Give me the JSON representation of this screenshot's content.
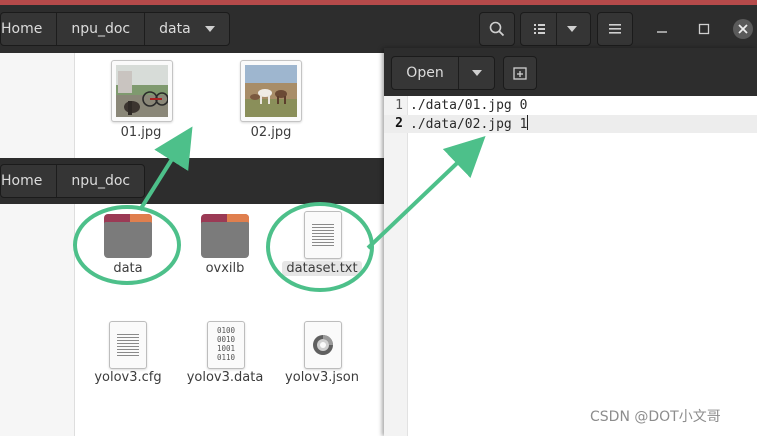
{
  "top_window": {
    "breadcrumbs": [
      "Home",
      "npu_doc",
      "data"
    ],
    "files": [
      {
        "name": "01.jpg"
      },
      {
        "name": "02.jpg"
      }
    ]
  },
  "front_window": {
    "breadcrumbs": [
      "Home",
      "npu_doc"
    ],
    "items": [
      {
        "name": "data",
        "kind": "folder"
      },
      {
        "name": "ovxilb",
        "kind": "folder"
      },
      {
        "name": "dataset.txt",
        "kind": "text-file"
      },
      {
        "name": "yolov3.cfg",
        "kind": "text-file"
      },
      {
        "name": "yolov3.data",
        "kind": "binary-file"
      },
      {
        "name": "yolov3.json",
        "kind": "json-file"
      }
    ],
    "binary_icon_text": "0100\n0010\n1001\n0110"
  },
  "editor": {
    "open_label": "Open",
    "lines": [
      {
        "num": "1",
        "text": "./data/01.jpg 0"
      },
      {
        "num": "2",
        "text": "./data/02.jpg 1"
      }
    ]
  },
  "annotation_color": "#4dc08a",
  "watermark": "CSDN @DOT小文哥"
}
